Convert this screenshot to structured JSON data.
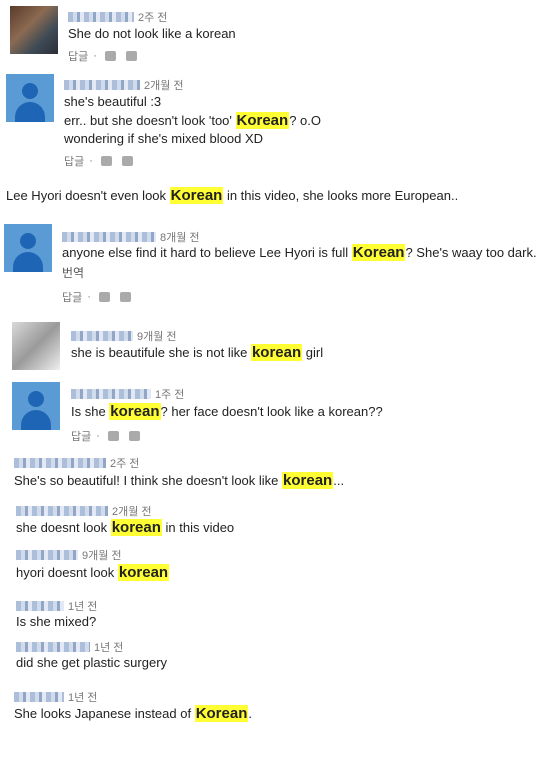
{
  "comments": [
    {
      "time": "2주 전",
      "lines": [
        {
          "pre": "She do not look like a korean",
          "hl": "",
          "post": ""
        }
      ],
      "reply": "답글"
    },
    {
      "time": "2개월 전",
      "lines": [
        {
          "pre": "she's beautiful :3",
          "hl": "",
          "post": ""
        },
        {
          "pre": "err.. but she doesn't look 'too' ",
          "hl": "Korean",
          "post": "? o.O"
        },
        {
          "pre": "wondering if she's mixed blood XD",
          "hl": "",
          "post": ""
        }
      ],
      "reply": "답글"
    },
    {
      "time": "",
      "lines": [
        {
          "pre": "Lee Hyori doesn't even look ",
          "hl": "Korean",
          "post": " in this video, she looks more European.."
        }
      ],
      "reply": ""
    },
    {
      "time": "8개월 전",
      "lines": [
        {
          "pre": "anyone else find it hard to believe Lee Hyori is full ",
          "hl": "Korean",
          "post": "? She's waay too dark."
        },
        {
          "pre": "번역",
          "hl": "",
          "post": ""
        }
      ],
      "reply": "답글"
    },
    {
      "time": "9개월 전",
      "lines": [
        {
          "pre": "she is beautifule she is not like ",
          "hl": "korean",
          "post": " girl"
        }
      ],
      "reply": ""
    },
    {
      "time": "1주 전",
      "lines": [
        {
          "pre": "Is she ",
          "hl": "korean",
          "post": "? her face doesn't look like a korean??"
        }
      ],
      "reply": "답글"
    },
    {
      "time": "2주 전",
      "lines": [
        {
          "pre": "She's so beautiful! I think she doesn't look like ",
          "hl": "korean",
          "post": "..."
        }
      ],
      "reply": ""
    },
    {
      "time": "2개월 전",
      "lines": [
        {
          "pre": "she doesnt look ",
          "hl": "korean",
          "post": " in this video"
        }
      ],
      "reply": ""
    },
    {
      "time": "9개월 전",
      "lines": [
        {
          "pre": "hyori doesnt look ",
          "hl": "korean",
          "post": ""
        }
      ],
      "reply": ""
    },
    {
      "time": "1년 전",
      "lines": [
        {
          "pre": "Is she mixed?",
          "hl": "",
          "post": ""
        }
      ],
      "reply": ""
    },
    {
      "time": "1년 전",
      "lines": [
        {
          "pre": "did she get plastic surgery",
          "hl": "",
          "post": ""
        }
      ],
      "reply": ""
    },
    {
      "time": "1년 전",
      "lines": [
        {
          "pre": "She looks Japanese instead of ",
          "hl": "Korean",
          "post": "."
        }
      ],
      "reply": ""
    }
  ],
  "icons": {
    "like": "thumbs-up-icon",
    "dislike": "thumbs-down-icon"
  },
  "colors": {
    "highlight": "#ffff33",
    "default_avatar": "#5b9bd5"
  }
}
